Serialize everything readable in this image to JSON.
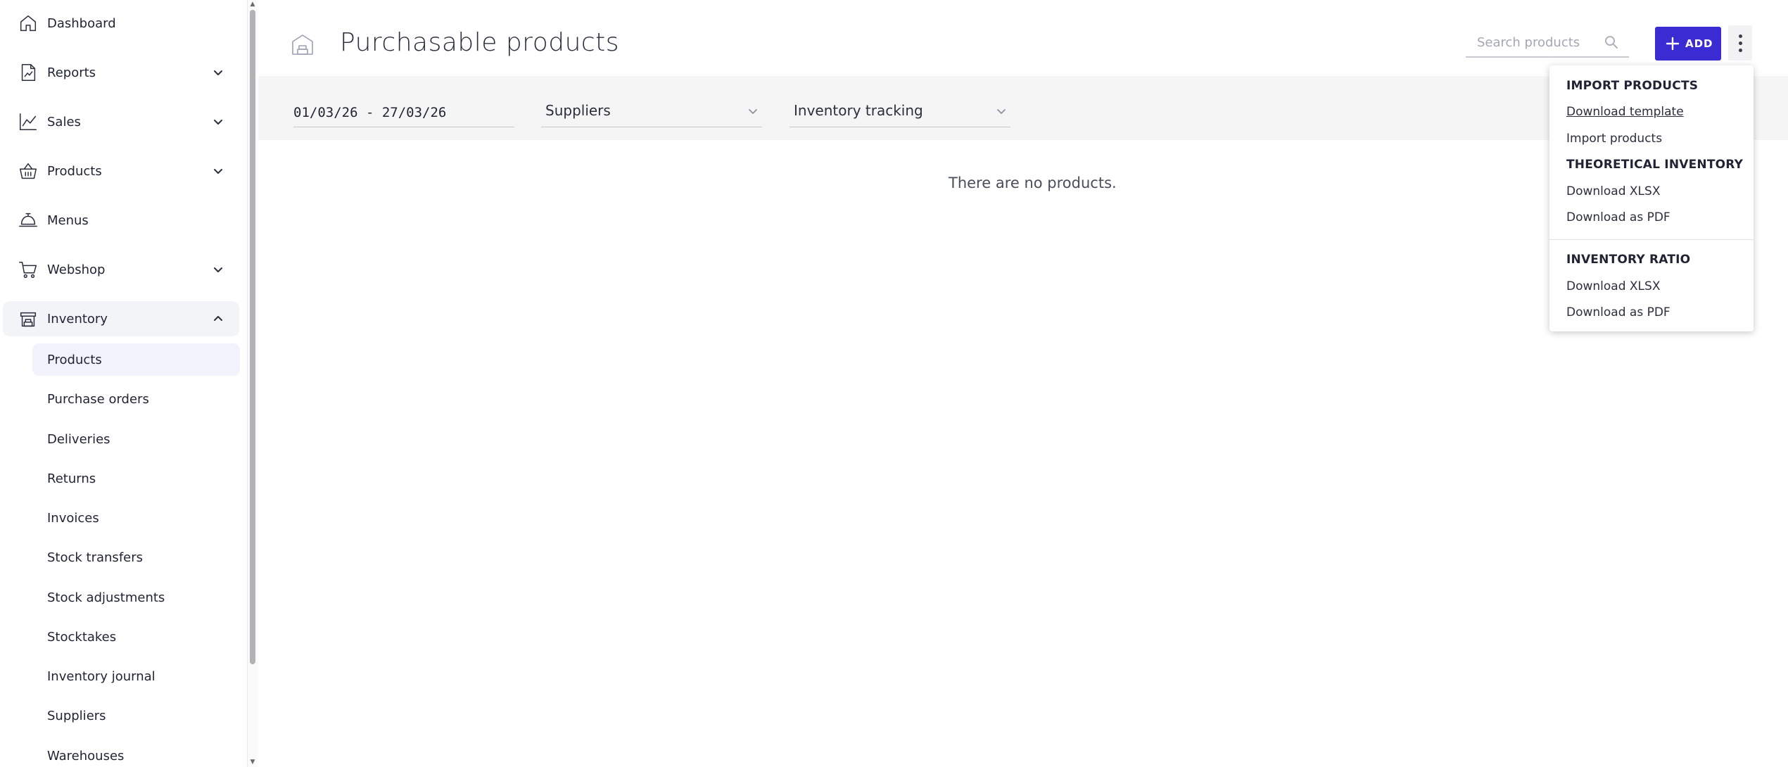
{
  "sidebar": {
    "items": [
      {
        "label": "Dashboard",
        "icon": "home-icon"
      },
      {
        "label": "Reports",
        "icon": "report-icon"
      },
      {
        "label": "Sales",
        "icon": "chart-line-icon"
      },
      {
        "label": "Products",
        "icon": "basket-icon"
      },
      {
        "label": "Menus",
        "icon": "bell-icon"
      },
      {
        "label": "Webshop",
        "icon": "cart-icon"
      },
      {
        "label": "Inventory",
        "icon": "warehouse-icon"
      }
    ],
    "inventory_sub": [
      "Products",
      "Purchase orders",
      "Deliveries",
      "Returns",
      "Invoices",
      "Stock transfers",
      "Stock adjustments",
      "Stocktakes",
      "Inventory journal",
      "Suppliers",
      "Warehouses"
    ]
  },
  "header": {
    "title": "Purchasable products",
    "search_placeholder": "Search products",
    "add_label": "ADD"
  },
  "filters": {
    "date_range": "01/03/26 - 27/03/26",
    "suppliers": "Suppliers",
    "tracking": "Inventory tracking"
  },
  "main": {
    "empty_text": "There are no products."
  },
  "menu": {
    "import_head": "IMPORT PRODUCTS",
    "download_template": "Download template",
    "import_products": "Import products",
    "theoretical_head": "THEORETICAL INVENTORY",
    "theoretical_xlsx": "Download XLSX",
    "theoretical_pdf": "Download as PDF",
    "ratio_head": "INVENTORY RATIO",
    "ratio_xlsx": "Download XLSX",
    "ratio_pdf": "Download as PDF"
  },
  "colors": {
    "accent": "#3b2bd3",
    "active_bg": "#f1f2fb",
    "filter_bg": "#f5f5f5"
  }
}
